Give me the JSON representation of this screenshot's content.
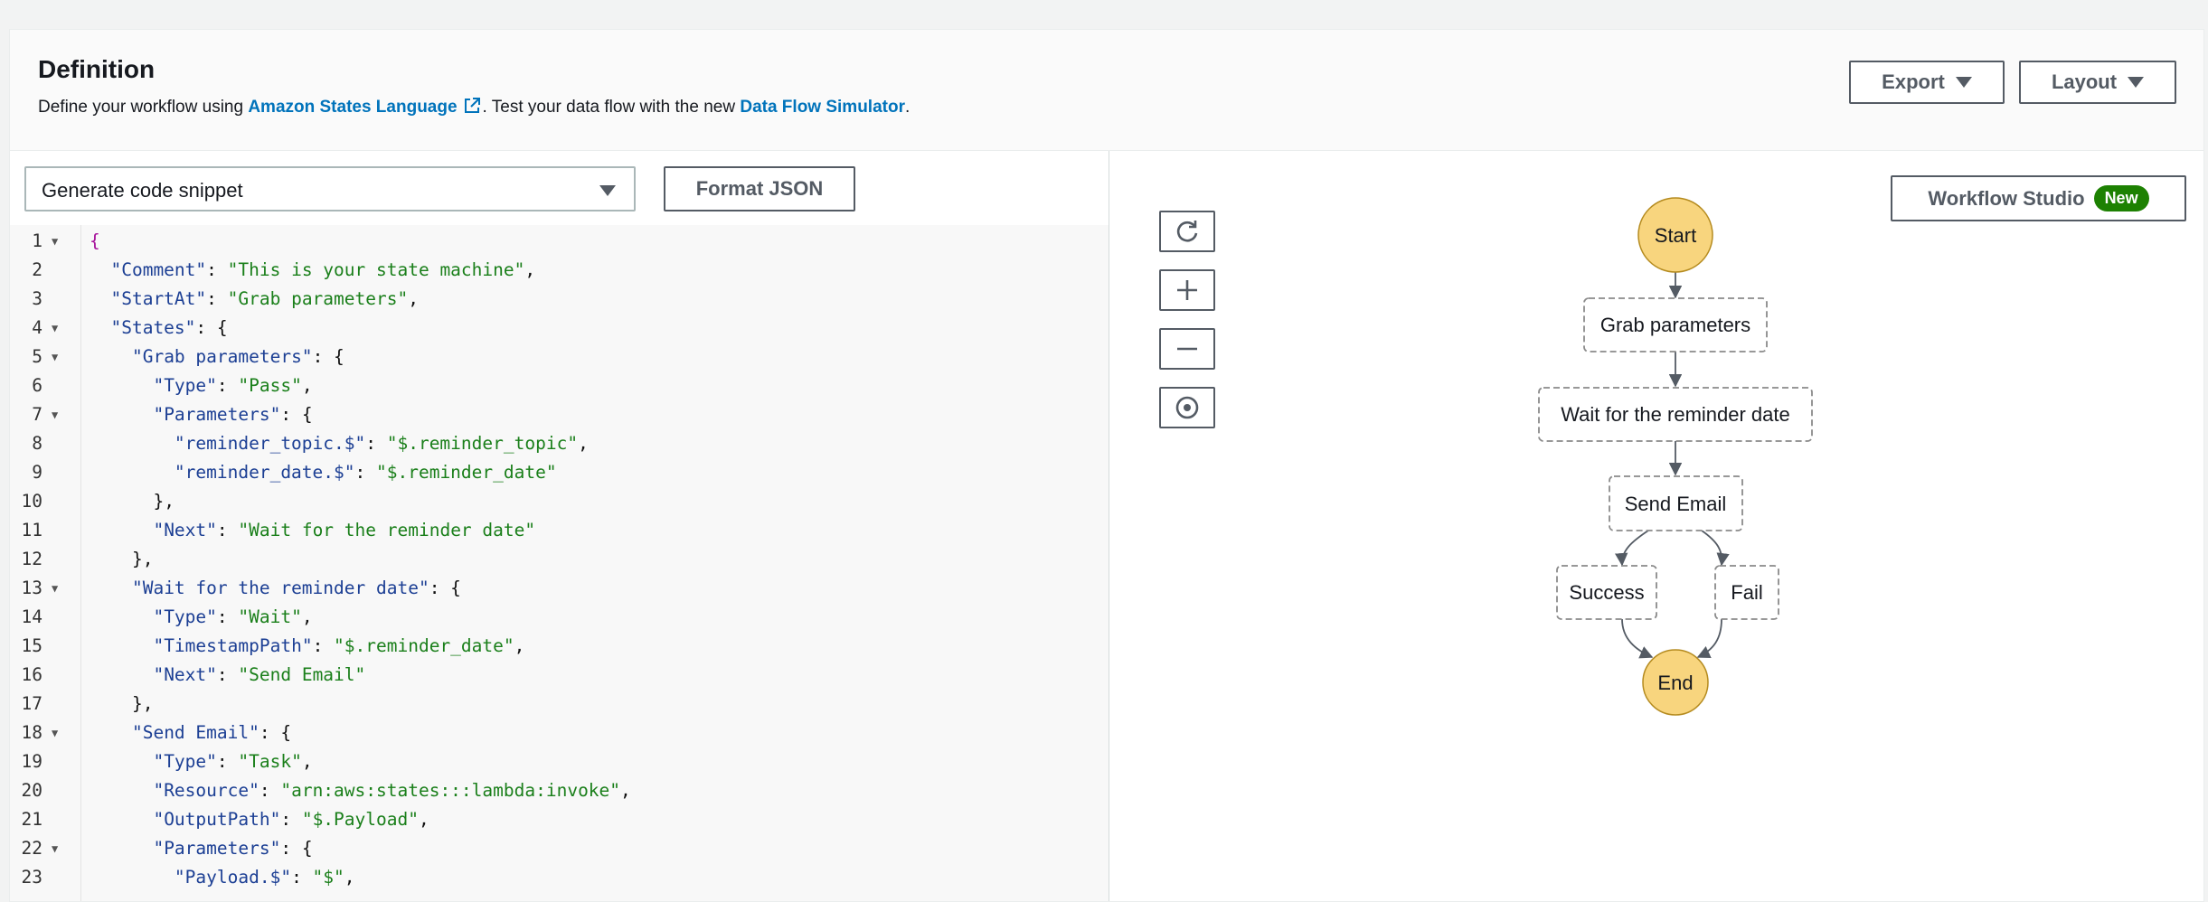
{
  "definition": {
    "title": "Definition",
    "subtitle_prefix": "Define your workflow using ",
    "asl_link": "Amazon States Language",
    "subtitle_mid": ". Test your data flow with the new ",
    "simulator_link": "Data Flow Simulator",
    "subtitle_suffix": ".",
    "export_label": "Export",
    "layout_label": "Layout"
  },
  "editor": {
    "snippet_select": "Generate code snippet",
    "format_json_label": "Format JSON",
    "lines": [
      {
        "n": "1",
        "fold": true
      },
      {
        "n": "2",
        "fold": false
      },
      {
        "n": "3",
        "fold": false
      },
      {
        "n": "4",
        "fold": true
      },
      {
        "n": "5",
        "fold": true
      },
      {
        "n": "6",
        "fold": false
      },
      {
        "n": "7",
        "fold": true
      },
      {
        "n": "8",
        "fold": false
      },
      {
        "n": "9",
        "fold": false
      },
      {
        "n": "10",
        "fold": false
      },
      {
        "n": "11",
        "fold": false
      },
      {
        "n": "12",
        "fold": false
      },
      {
        "n": "13",
        "fold": true
      },
      {
        "n": "14",
        "fold": false
      },
      {
        "n": "15",
        "fold": false
      },
      {
        "n": "16",
        "fold": false
      },
      {
        "n": "17",
        "fold": false
      },
      {
        "n": "18",
        "fold": true
      },
      {
        "n": "19",
        "fold": false
      },
      {
        "n": "20",
        "fold": false
      },
      {
        "n": "21",
        "fold": false
      },
      {
        "n": "22",
        "fold": true
      },
      {
        "n": "23",
        "fold": false
      }
    ],
    "code": {
      "l1_open": "{",
      "comment_key": "\"Comment\"",
      "comment_val": "\"This is your state machine\"",
      "startat_key": "\"StartAt\"",
      "startat_val": "\"Grab parameters\"",
      "states_key": "\"States\"",
      "grab_key": "\"Grab parameters\"",
      "type_key": "\"Type\"",
      "pass_val": "\"Pass\"",
      "parameters_key": "\"Parameters\"",
      "reminder_topic_key": "\"reminder_topic.$\"",
      "reminder_topic_val": "\"$.reminder_topic\"",
      "reminder_date_key": "\"reminder_date.$\"",
      "reminder_date_val": "\"$.reminder_date\"",
      "close_comma": "},",
      "next_key": "\"Next\"",
      "wait_next_val": "\"Wait for the reminder date\"",
      "wait_key": "\"Wait for the reminder date\"",
      "wait_val": "\"Wait\"",
      "timestamp_key": "\"TimestampPath\"",
      "timestamp_val": "\"$.reminder_date\"",
      "send_next_val": "\"Send Email\"",
      "send_key": "\"Send Email\"",
      "task_val": "\"Task\"",
      "resource_key": "\"Resource\"",
      "resource_val": "\"arn:aws:states:::lambda:invoke\"",
      "output_key": "\"OutputPath\"",
      "output_val": "\"$.Payload\"",
      "payload_key": "\"Payload.$\"",
      "payload_val": "\"$\""
    }
  },
  "graph": {
    "workflow_studio_label": "Workflow Studio",
    "new_badge": "New",
    "tools": [
      "refresh-icon",
      "zoom-in-icon",
      "zoom-out-icon",
      "center-icon"
    ],
    "nodes": {
      "start": "Start",
      "grab": "Grab parameters",
      "wait": "Wait for the reminder date",
      "send": "Send Email",
      "success": "Success",
      "fail": "Fail",
      "end": "End"
    },
    "colors": {
      "terminal_fill": "#f8d57e",
      "terminal_stroke": "#b58b1f",
      "state_stroke": "#8a8a8a"
    }
  }
}
